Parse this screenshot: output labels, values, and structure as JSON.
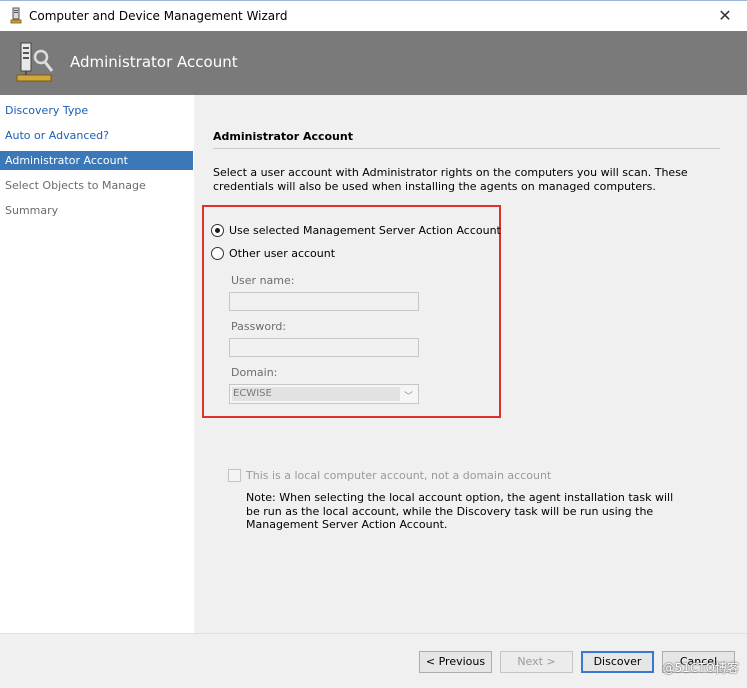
{
  "window": {
    "title": "Computer and Device Management Wizard",
    "close_glyph": "✕"
  },
  "banner": {
    "title": "Administrator Account",
    "icon": "wizard-server-icon"
  },
  "nav": {
    "items": [
      {
        "label": "Discovery Type",
        "state": "link"
      },
      {
        "label": "Auto or Advanced?",
        "state": "link"
      },
      {
        "label": "Administrator Account",
        "state": "active"
      },
      {
        "label": "Select Objects to Manage",
        "state": "dim"
      },
      {
        "label": "Summary",
        "state": "dim"
      }
    ]
  },
  "content": {
    "section_title": "Administrator Account",
    "description": "Select a user account with Administrator rights on the computers you will scan. These credentials will also be used when installing the agents on managed computers.",
    "options": [
      {
        "label": "Use selected Management Server Action Account",
        "checked": true
      },
      {
        "label": "Other user account",
        "checked": false
      }
    ],
    "fields": {
      "username_label": "User name:",
      "username_value": "",
      "password_label": "Password:",
      "password_value": "",
      "domain_label": "Domain:",
      "domain_value": "ECWISE"
    },
    "local_account_check": "This is a local computer account, not a domain account",
    "note": "Note:  When selecting the local account option, the agent installation task will be run as the local account, while the Discovery task will be run using the Management Server Action Account."
  },
  "buttons": {
    "previous": "< Previous",
    "next": "Next >",
    "discover": "Discover",
    "cancel": "Cancel"
  },
  "watermark": "@51CTO博客",
  "colors": {
    "banner": "#7a7a7a",
    "nav_active": "#3a78b8",
    "highlight_box": "#e0302a",
    "link": "#1a5fb4"
  }
}
